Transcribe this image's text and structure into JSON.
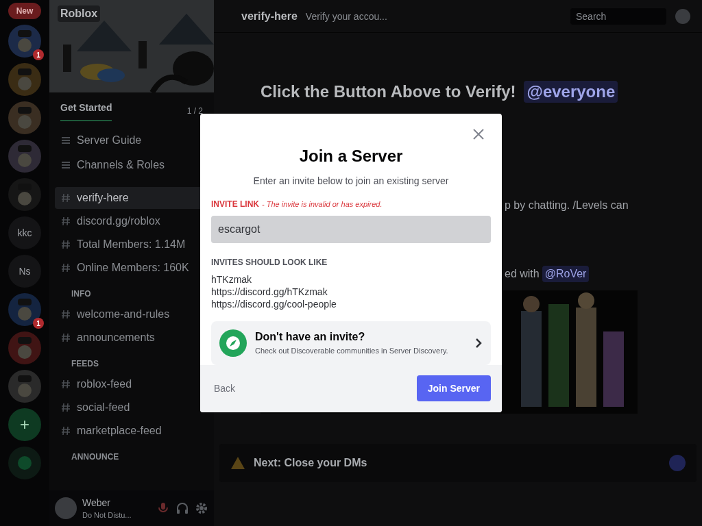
{
  "server_rail": [
    {
      "kind": "pill",
      "label": "New"
    },
    {
      "kind": "picture",
      "badge": "1"
    },
    {
      "kind": "picture"
    },
    {
      "kind": "picture"
    },
    {
      "kind": "picture"
    },
    {
      "kind": "picture"
    },
    {
      "kind": "text",
      "label": "kkc"
    },
    {
      "kind": "text",
      "label": "Ns"
    },
    {
      "kind": "picture",
      "badge": "1"
    },
    {
      "kind": "picture"
    },
    {
      "kind": "picture"
    },
    {
      "kind": "add",
      "label": "+"
    },
    {
      "kind": "explore"
    }
  ],
  "sidebar": {
    "server_name": "Roblox",
    "get_started": "Get Started",
    "pager": "1 / 2",
    "guide_items": [
      "Server Guide",
      "Channels & Roles"
    ],
    "channels": [
      {
        "kind": "channel",
        "name": "verify-here",
        "selected": true
      },
      {
        "kind": "channel",
        "name": "discord.gg/roblox",
        "selected": false
      },
      {
        "kind": "channel",
        "name": "Total Members: 1.14M",
        "selected": false
      },
      {
        "kind": "channel",
        "name": "Online Members: 160K",
        "selected": false
      },
      {
        "kind": "category",
        "name": "INFO"
      },
      {
        "kind": "channel",
        "name": "welcome-and-rules",
        "selected": false
      },
      {
        "kind": "channel",
        "name": "announcements",
        "selected": false
      },
      {
        "kind": "category",
        "name": "FEEDS"
      },
      {
        "kind": "channel",
        "name": "roblox-feed",
        "selected": false
      },
      {
        "kind": "channel",
        "name": "social-feed",
        "selected": false
      },
      {
        "kind": "channel",
        "name": "marketplace-feed",
        "selected": false
      },
      {
        "kind": "category",
        "name": "ANNOUNCE"
      }
    ],
    "user": {
      "name": "Weber",
      "status": "Do Not Distu..."
    }
  },
  "header": {
    "channel": "verify-here",
    "topic": "Verify your accou...",
    "search_placeholder": "Search"
  },
  "messages": {
    "heading": "Click the Button Above to Verify!",
    "mention": "@everyone",
    "fragment_1": "p by chatting. /Levels can",
    "fragment_2": "ed with",
    "mention_2": "@RoVer",
    "notice": "Next: Close your DMs"
  },
  "modal": {
    "title": "Join a Server",
    "subtitle": "Enter an invite below to join an existing server",
    "label": "INVITE LINK",
    "error": "- The invite is invalid or has expired.",
    "value": "escargot",
    "examples_title": "INVITES SHOULD LOOK LIKE",
    "examples": [
      "hTKzmak",
      "https://discord.gg/hTKzmak",
      "https://discord.gg/cool-people"
    ],
    "discover_title": "Don't have an invite?",
    "discover_text": "Check out Discoverable communities in Server Discovery.",
    "back": "Back",
    "submit": "Join Server"
  }
}
